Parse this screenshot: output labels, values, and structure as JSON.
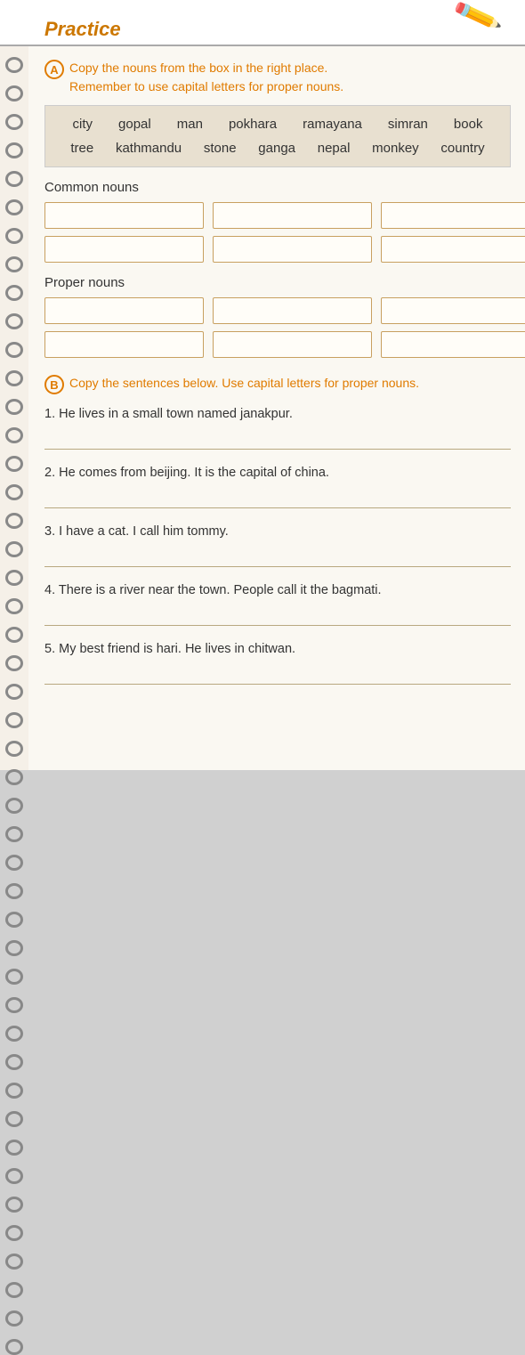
{
  "header": {
    "title": "Practice"
  },
  "section_a": {
    "circle_label": "A",
    "instruction_line1": "Copy the nouns from the box in the right place.",
    "instruction_line2": "Remember to use capital letters for proper nouns.",
    "words_row1": [
      "city",
      "gopal",
      "man",
      "pokhara",
      "ramayana",
      "simran",
      "book"
    ],
    "words_row2": [
      "tree",
      "kathmandu",
      "stone",
      "ganga",
      "nepal",
      "monkey",
      "country"
    ],
    "common_nouns_label": "Common nouns",
    "proper_nouns_label": "Proper nouns"
  },
  "section_b": {
    "circle_label": "B",
    "instruction": "Copy the sentences below. Use capital letters for proper nouns.",
    "sentences": [
      "1. He lives in a small town named janakpur.",
      "2. He comes from beijing. It is the capital of china.",
      "3. I have a cat. I call him tommy.",
      "4. There is a river near the town. People call it the bagmati.",
      "5. My best friend is hari. He lives in chitwan."
    ]
  }
}
